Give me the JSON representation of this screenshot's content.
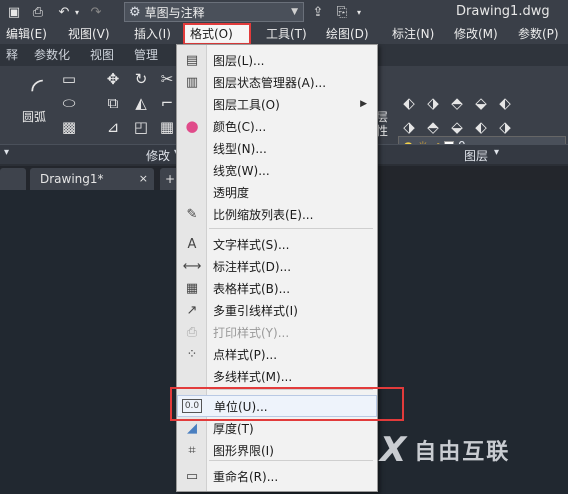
{
  "title": "Drawing1.dwg",
  "workspace": "草图与注释",
  "menubar": [
    {
      "label": "编辑(E)"
    },
    {
      "label": "视图(V)"
    },
    {
      "label": "插入(I)"
    },
    {
      "label": "格式(O)",
      "active": true
    },
    {
      "label": "工具(T)"
    },
    {
      "label": "绘图(D)"
    },
    {
      "label": "标注(N)"
    },
    {
      "label": "修改(M)"
    },
    {
      "label": "参数(P)"
    }
  ],
  "ribbon_tabs": [
    "释",
    "参数化",
    "视图",
    "管理"
  ],
  "ribbon": {
    "arc_label": "圆弧",
    "modify_panel": "修改",
    "layer_panel": "图层",
    "layer_value": "0",
    "layer_text": "层性"
  },
  "file_tabs": [
    {
      "label": "Drawing1*"
    }
  ],
  "dropdown": {
    "items": [
      {
        "label": "图层(L)...",
        "icon": "layers-icon",
        "glyph": "▤"
      },
      {
        "label": "图层状态管理器(A)...",
        "icon": "layer-state-icon",
        "glyph": "▥"
      },
      {
        "label": "图层工具(O)",
        "icon": "",
        "glyph": "",
        "submenu": true
      },
      {
        "label": "颜色(C)...",
        "icon": "color-wheel-icon",
        "glyph": "●"
      },
      {
        "label": "线型(N)...",
        "icon": "",
        "glyph": ""
      },
      {
        "label": "线宽(W)...",
        "icon": "",
        "glyph": ""
      },
      {
        "label": "透明度",
        "icon": "",
        "glyph": ""
      },
      {
        "label": "比例缩放列表(E)...",
        "icon": "scale-list-icon",
        "glyph": "✎"
      },
      {
        "separator": true
      },
      {
        "label": "文字样式(S)...",
        "icon": "text-style-icon",
        "glyph": "A"
      },
      {
        "label": "标注样式(D)...",
        "icon": "dim-style-icon",
        "glyph": "⟷"
      },
      {
        "label": "表格样式(B)...",
        "icon": "table-style-icon",
        "glyph": "▦"
      },
      {
        "label": "多重引线样式(I)",
        "icon": "multileader-icon",
        "glyph": "↗"
      },
      {
        "label": "打印样式(Y)...",
        "icon": "print-style-icon",
        "glyph": "⎙",
        "disabled": true
      },
      {
        "label": "点样式(P)...",
        "icon": "point-style-icon",
        "glyph": "⁘"
      },
      {
        "label": "多线样式(M)...",
        "icon": "",
        "glyph": ""
      },
      {
        "separator": true
      },
      {
        "label": "单位(U)...",
        "icon": "units-icon",
        "glyph": "0.0",
        "highlight": true
      },
      {
        "label": "厚度(T)",
        "icon": "thickness-icon",
        "glyph": "◢"
      },
      {
        "label": "图形界限(I)",
        "icon": "limits-icon",
        "glyph": "⌗"
      },
      {
        "separator": true
      },
      {
        "label": "重命名(R)...",
        "icon": "rename-icon",
        "glyph": "▭"
      }
    ]
  },
  "watermark": {
    "mark": "X",
    "text": "自由互联"
  },
  "colors": {
    "accent_red": "#e23b3b",
    "menu_bg": "#f2f2f2",
    "app_dark": "#2b2f36"
  }
}
